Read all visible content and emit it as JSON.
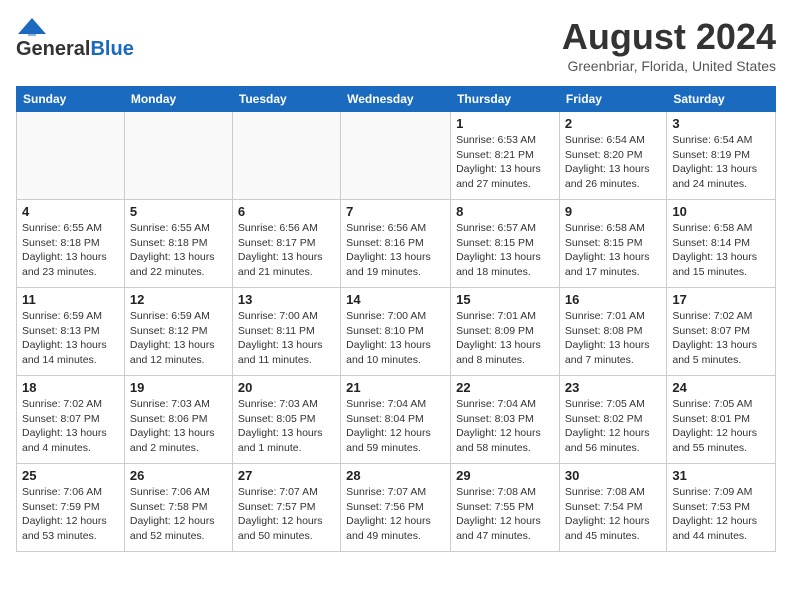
{
  "header": {
    "logo_general": "General",
    "logo_blue": "Blue",
    "month": "August 2024",
    "location": "Greenbriar, Florida, United States"
  },
  "days_of_week": [
    "Sunday",
    "Monday",
    "Tuesday",
    "Wednesday",
    "Thursday",
    "Friday",
    "Saturday"
  ],
  "weeks": [
    [
      {
        "day": "",
        "info": ""
      },
      {
        "day": "",
        "info": ""
      },
      {
        "day": "",
        "info": ""
      },
      {
        "day": "",
        "info": ""
      },
      {
        "day": "1",
        "info": "Sunrise: 6:53 AM\nSunset: 8:21 PM\nDaylight: 13 hours\nand 27 minutes."
      },
      {
        "day": "2",
        "info": "Sunrise: 6:54 AM\nSunset: 8:20 PM\nDaylight: 13 hours\nand 26 minutes."
      },
      {
        "day": "3",
        "info": "Sunrise: 6:54 AM\nSunset: 8:19 PM\nDaylight: 13 hours\nand 24 minutes."
      }
    ],
    [
      {
        "day": "4",
        "info": "Sunrise: 6:55 AM\nSunset: 8:18 PM\nDaylight: 13 hours\nand 23 minutes."
      },
      {
        "day": "5",
        "info": "Sunrise: 6:55 AM\nSunset: 8:18 PM\nDaylight: 13 hours\nand 22 minutes."
      },
      {
        "day": "6",
        "info": "Sunrise: 6:56 AM\nSunset: 8:17 PM\nDaylight: 13 hours\nand 21 minutes."
      },
      {
        "day": "7",
        "info": "Sunrise: 6:56 AM\nSunset: 8:16 PM\nDaylight: 13 hours\nand 19 minutes."
      },
      {
        "day": "8",
        "info": "Sunrise: 6:57 AM\nSunset: 8:15 PM\nDaylight: 13 hours\nand 18 minutes."
      },
      {
        "day": "9",
        "info": "Sunrise: 6:58 AM\nSunset: 8:15 PM\nDaylight: 13 hours\nand 17 minutes."
      },
      {
        "day": "10",
        "info": "Sunrise: 6:58 AM\nSunset: 8:14 PM\nDaylight: 13 hours\nand 15 minutes."
      }
    ],
    [
      {
        "day": "11",
        "info": "Sunrise: 6:59 AM\nSunset: 8:13 PM\nDaylight: 13 hours\nand 14 minutes."
      },
      {
        "day": "12",
        "info": "Sunrise: 6:59 AM\nSunset: 8:12 PM\nDaylight: 13 hours\nand 12 minutes."
      },
      {
        "day": "13",
        "info": "Sunrise: 7:00 AM\nSunset: 8:11 PM\nDaylight: 13 hours\nand 11 minutes."
      },
      {
        "day": "14",
        "info": "Sunrise: 7:00 AM\nSunset: 8:10 PM\nDaylight: 13 hours\nand 10 minutes."
      },
      {
        "day": "15",
        "info": "Sunrise: 7:01 AM\nSunset: 8:09 PM\nDaylight: 13 hours\nand 8 minutes."
      },
      {
        "day": "16",
        "info": "Sunrise: 7:01 AM\nSunset: 8:08 PM\nDaylight: 13 hours\nand 7 minutes."
      },
      {
        "day": "17",
        "info": "Sunrise: 7:02 AM\nSunset: 8:07 PM\nDaylight: 13 hours\nand 5 minutes."
      }
    ],
    [
      {
        "day": "18",
        "info": "Sunrise: 7:02 AM\nSunset: 8:07 PM\nDaylight: 13 hours\nand 4 minutes."
      },
      {
        "day": "19",
        "info": "Sunrise: 7:03 AM\nSunset: 8:06 PM\nDaylight: 13 hours\nand 2 minutes."
      },
      {
        "day": "20",
        "info": "Sunrise: 7:03 AM\nSunset: 8:05 PM\nDaylight: 13 hours\nand 1 minute."
      },
      {
        "day": "21",
        "info": "Sunrise: 7:04 AM\nSunset: 8:04 PM\nDaylight: 12 hours\nand 59 minutes."
      },
      {
        "day": "22",
        "info": "Sunrise: 7:04 AM\nSunset: 8:03 PM\nDaylight: 12 hours\nand 58 minutes."
      },
      {
        "day": "23",
        "info": "Sunrise: 7:05 AM\nSunset: 8:02 PM\nDaylight: 12 hours\nand 56 minutes."
      },
      {
        "day": "24",
        "info": "Sunrise: 7:05 AM\nSunset: 8:01 PM\nDaylight: 12 hours\nand 55 minutes."
      }
    ],
    [
      {
        "day": "25",
        "info": "Sunrise: 7:06 AM\nSunset: 7:59 PM\nDaylight: 12 hours\nand 53 minutes."
      },
      {
        "day": "26",
        "info": "Sunrise: 7:06 AM\nSunset: 7:58 PM\nDaylight: 12 hours\nand 52 minutes."
      },
      {
        "day": "27",
        "info": "Sunrise: 7:07 AM\nSunset: 7:57 PM\nDaylight: 12 hours\nand 50 minutes."
      },
      {
        "day": "28",
        "info": "Sunrise: 7:07 AM\nSunset: 7:56 PM\nDaylight: 12 hours\nand 49 minutes."
      },
      {
        "day": "29",
        "info": "Sunrise: 7:08 AM\nSunset: 7:55 PM\nDaylight: 12 hours\nand 47 minutes."
      },
      {
        "day": "30",
        "info": "Sunrise: 7:08 AM\nSunset: 7:54 PM\nDaylight: 12 hours\nand 45 minutes."
      },
      {
        "day": "31",
        "info": "Sunrise: 7:09 AM\nSunset: 7:53 PM\nDaylight: 12 hours\nand 44 minutes."
      }
    ]
  ]
}
